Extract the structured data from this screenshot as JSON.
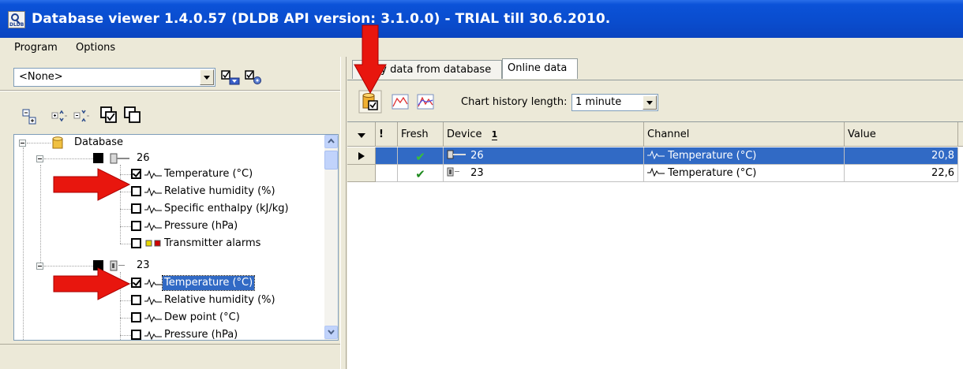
{
  "window": {
    "title": "Database viewer  1.4.0.57  (DLDB API version: 3.1.0.0) - TRIAL till 30.6.2010.",
    "app_icon_label": "DLDB"
  },
  "menu": [
    "Program",
    "Options"
  ],
  "left": {
    "combo_value": "<None>",
    "toolbar_icons": [
      "save-config-icon",
      "config-settings-icon"
    ],
    "tree_toolbar_icons": [
      "collapse-all-icon",
      "expand-icon",
      "collapse-icon",
      "check-all-icon",
      "uncheck-all-icon"
    ],
    "tree": {
      "root": "Database",
      "devices": [
        {
          "name": "26",
          "channels": [
            {
              "label": "Temperature (°C)",
              "checked": true,
              "selected": false
            },
            {
              "label": "Relative humidity (%)",
              "checked": false,
              "selected": false
            },
            {
              "label": "Specific enthalpy (kJ/kg)",
              "checked": false,
              "selected": false
            },
            {
              "label": "Pressure (hPa)",
              "checked": false,
              "selected": false
            },
            {
              "label": "Transmitter alarms",
              "checked": false,
              "selected": false,
              "alarm": true
            }
          ]
        },
        {
          "name": "23",
          "channels": [
            {
              "label": "Temperature (°C)",
              "checked": true,
              "selected": true
            },
            {
              "label": "Relative humidity (%)",
              "checked": false,
              "selected": false
            },
            {
              "label": "Dew point (°C)",
              "checked": false,
              "selected": false
            },
            {
              "label": "Pressure (hPa)",
              "checked": false,
              "selected": false
            }
          ]
        }
      ]
    }
  },
  "right": {
    "tabs": [
      "History data from database",
      "Online data"
    ],
    "tab_visible_texts": [
      "ory data from database",
      "Online data"
    ],
    "active_tab": "Online data",
    "chart_history_label": "Chart history length:",
    "chart_history_value": "1 minute",
    "grid": {
      "columns": [
        "!",
        "Fresh",
        "Device",
        "Channel",
        "Value"
      ],
      "sort_indicator": "1",
      "rows": [
        {
          "fresh": "✔",
          "device": "26",
          "channel": "Temperature (°C)",
          "value": "20,8",
          "selected": true
        },
        {
          "fresh": "✔",
          "device": "23",
          "channel": "Temperature (°C)",
          "value": "22,6",
          "selected": false
        }
      ]
    }
  },
  "colors": {
    "titlebar": "#0a4ccd",
    "selection": "#316ac5",
    "arrow": "#e8160e",
    "fresh_check": "#1e8a1e"
  }
}
